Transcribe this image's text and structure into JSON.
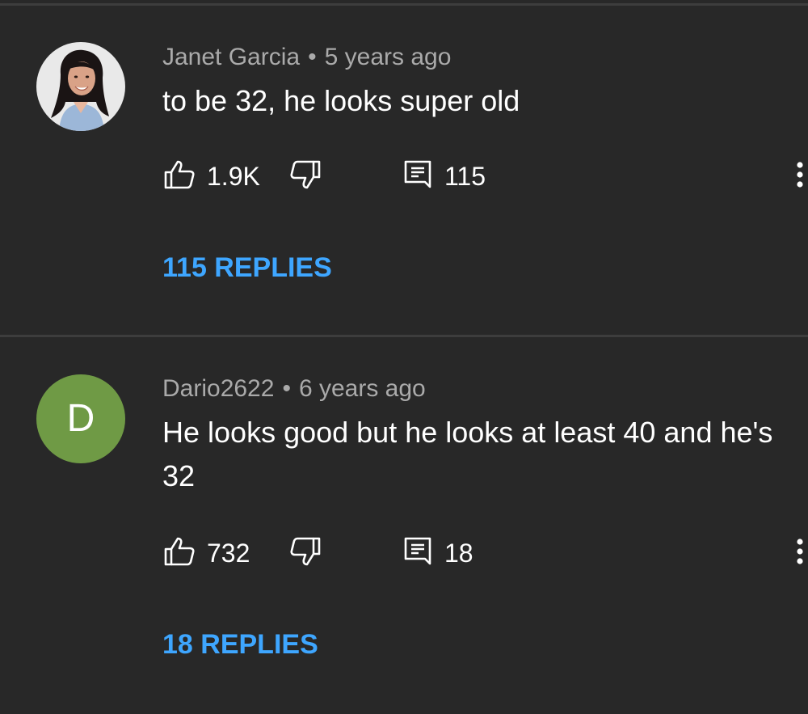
{
  "comments": [
    {
      "author": "Janet Garcia",
      "separator": "•",
      "time": "5 years ago",
      "text": "to be 32, he looks super old",
      "likes": "1.9K",
      "reply_count": "115",
      "replies_label": "115 REPLIES",
      "avatar_type": "photo"
    },
    {
      "author": "Dario2622",
      "separator": "•",
      "time": "6 years ago",
      "text": "He looks good but he looks at least 40 and he's 32",
      "likes": "732",
      "reply_count": "18",
      "replies_label": "18 REPLIES",
      "avatar_type": "letter",
      "avatar_letter": "D",
      "avatar_color": "#6f9a45"
    }
  ],
  "icons": {
    "like": "thumbs-up-icon",
    "dislike": "thumbs-down-icon",
    "reply": "comment-icon",
    "more": "more-vertical-icon"
  },
  "colors": {
    "background": "#282828",
    "link": "#3ea6ff",
    "meta": "#aaaaaa",
    "text": "#ffffff"
  }
}
